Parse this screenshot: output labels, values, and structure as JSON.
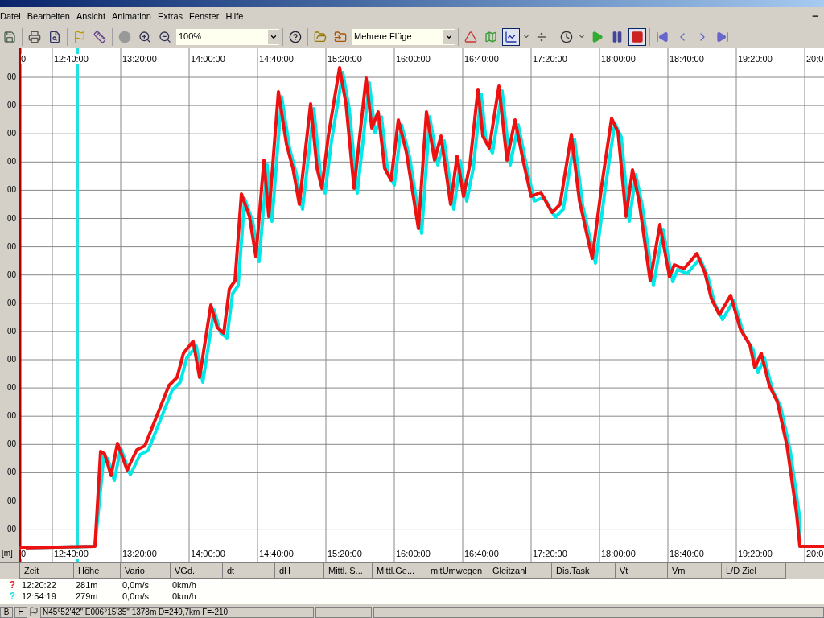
{
  "menu": [
    {
      "label": "Datei"
    },
    {
      "label": "Bearbeiten"
    },
    {
      "label": "Ansicht"
    },
    {
      "label": "Animation"
    },
    {
      "label": "Extras"
    },
    {
      "label": "Fenster"
    },
    {
      "label": "Hilfe"
    }
  ],
  "toolbar": {
    "groups": [
      [
        {
          "kind": "save",
          "pressed": false
        }
      ],
      [
        {
          "kind": "print",
          "pressed": false
        },
        {
          "kind": "preview",
          "pressed": false
        }
      ],
      [
        {
          "kind": "flag",
          "pressed": false
        },
        {
          "kind": "measure",
          "pressed": false
        }
      ],
      [
        {
          "kind": "sphere",
          "pressed": false
        },
        {
          "kind": "zoom_in",
          "pressed": false
        },
        {
          "kind": "zoom_out",
          "pressed": false
        },
        {
          "kind": "zoom_select",
          "value": "100%"
        }
      ],
      [
        {
          "kind": "help",
          "pressed": false
        }
      ],
      [
        {
          "kind": "open",
          "pressed": false
        },
        {
          "kind": "folder",
          "pressed": false
        },
        {
          "kind": "flight_select",
          "value": "Mehrere Flüge"
        }
      ],
      [
        {
          "kind": "triangle",
          "pressed": false
        },
        {
          "kind": "map",
          "pressed": false
        },
        {
          "kind": "chart",
          "pressed": true
        },
        {
          "kind": "caret",
          "pressed": false
        },
        {
          "kind": "ratio",
          "pressed": false
        }
      ],
      [
        {
          "kind": "clock",
          "pressed": false
        },
        {
          "kind": "caret",
          "pressed": false
        },
        {
          "kind": "play",
          "pressed": false
        },
        {
          "kind": "pause",
          "pressed": false
        },
        {
          "kind": "stop",
          "pressed": true
        }
      ],
      [
        {
          "kind": "first",
          "pressed": false
        },
        {
          "kind": "prev",
          "pressed": false
        },
        {
          "kind": "next",
          "pressed": false
        },
        {
          "kind": "last",
          "pressed": false
        }
      ]
    ]
  },
  "chart": {
    "y_labels": [
      "00",
      "00",
      "00",
      "00",
      "00",
      "00",
      "00",
      "00",
      "00",
      "00",
      "00",
      "00",
      "00",
      "00",
      "00",
      "00",
      "00"
    ],
    "y_unit": "[m]",
    "top_ticks": [
      "0",
      "12:40:00",
      "13:20:00",
      "14:00:00",
      "14:40:00",
      "15:20:00",
      "16:00:00",
      "16:40:00",
      "17:20:00",
      "18:00:00",
      "18:40:00",
      "19:20:00",
      "20:0"
    ],
    "bottom_ticks": [
      "0",
      "12:40:00",
      "13:20:00",
      "14:00:00",
      "14:40:00",
      "15:20:00",
      "16:00:00",
      "16:40:00",
      "17:20:00",
      "18:00:00",
      "18:40:00",
      "19:20:00",
      "20:0"
    ],
    "tracks": [
      {
        "color": "#00e8e8"
      },
      {
        "color": "#ee1111"
      }
    ]
  },
  "table": {
    "columns": [
      "Zeit",
      "Höhe",
      "Vario",
      "VGd.",
      "dt",
      "dH",
      "Mittl. S...",
      "Mittl.Ge...",
      "mitUmwegen",
      "Gleitzahl",
      "Dis.Task",
      "Vt",
      "Vm",
      "L/D Ziel"
    ],
    "rows": [
      {
        "marker": "?",
        "color": "#dd2222",
        "cells": [
          "12:20:22",
          "281m",
          "0,0m/s",
          "0km/h"
        ]
      },
      {
        "marker": "?",
        "color": "#22dddd",
        "cells": [
          "12:54:19",
          "279m",
          "0,0m/s",
          "0km/h"
        ]
      }
    ]
  },
  "status_bar": {
    "buttons": [
      "B",
      "H"
    ],
    "text": "N45°52'42\" E006°15'35\" 1378m  D=249,7km F=-210"
  }
}
